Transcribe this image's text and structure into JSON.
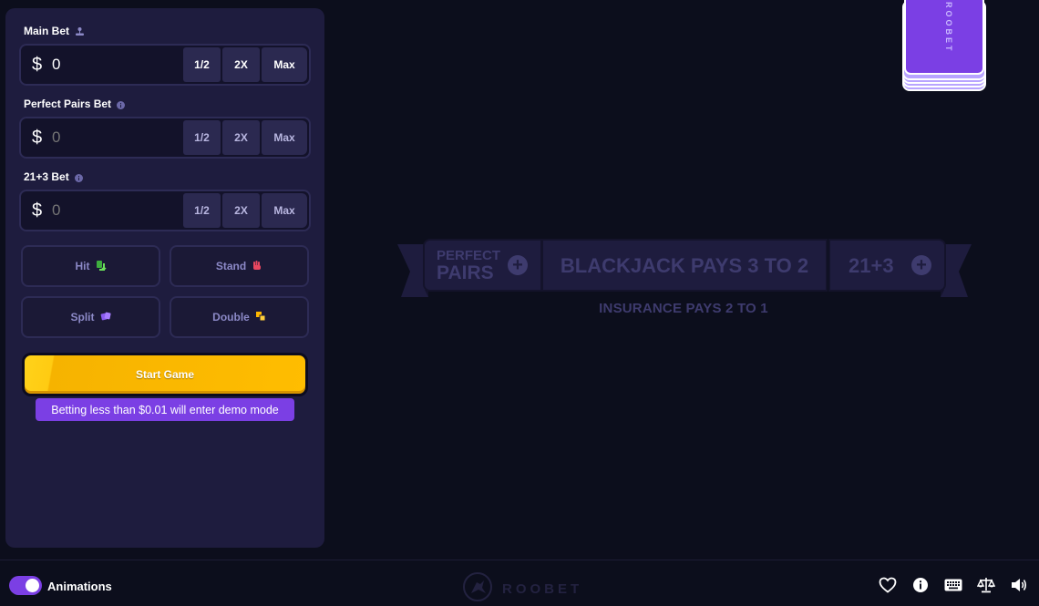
{
  "panel": {
    "main_bet": {
      "label": "Main Bet",
      "currency": "$",
      "value": "0",
      "half": "1/2",
      "double": "2X",
      "max": "Max"
    },
    "perfect_pairs_bet": {
      "label": "Perfect Pairs Bet",
      "currency": "$",
      "placeholder": "0",
      "half": "1/2",
      "double": "2X",
      "max": "Max"
    },
    "twentyone_bet": {
      "label": "21+3 Bet",
      "currency": "$",
      "placeholder": "0",
      "half": "1/2",
      "double": "2X",
      "max": "Max"
    },
    "actions": {
      "hit": "Hit",
      "stand": "Stand",
      "split": "Split",
      "double": "Double"
    },
    "start_label": "Start Game",
    "demo_notice": "Betting less than $0.01 will enter demo mode"
  },
  "table": {
    "perfect_pairs_line1": "PERFECT",
    "perfect_pairs_line2": "PAIRS",
    "blackjack_pays": "BLACKJACK PAYS 3 TO 2",
    "twentyone": "21+3",
    "insurance": "INSURANCE PAYS 2 TO 1",
    "deck_brand": "ROOBET"
  },
  "footer": {
    "animations_label": "Animations",
    "animations_on": true,
    "logo_text": "ROOBET",
    "icons": [
      "heart-icon",
      "info-icon",
      "keyboard-icon",
      "balance-icon",
      "volume-icon"
    ]
  },
  "colors": {
    "accent_purple": "#7b3fe4",
    "start_yellow": "#ffbd00",
    "panel_bg": "#1e1c3e",
    "page_bg": "#0c0e1c"
  }
}
